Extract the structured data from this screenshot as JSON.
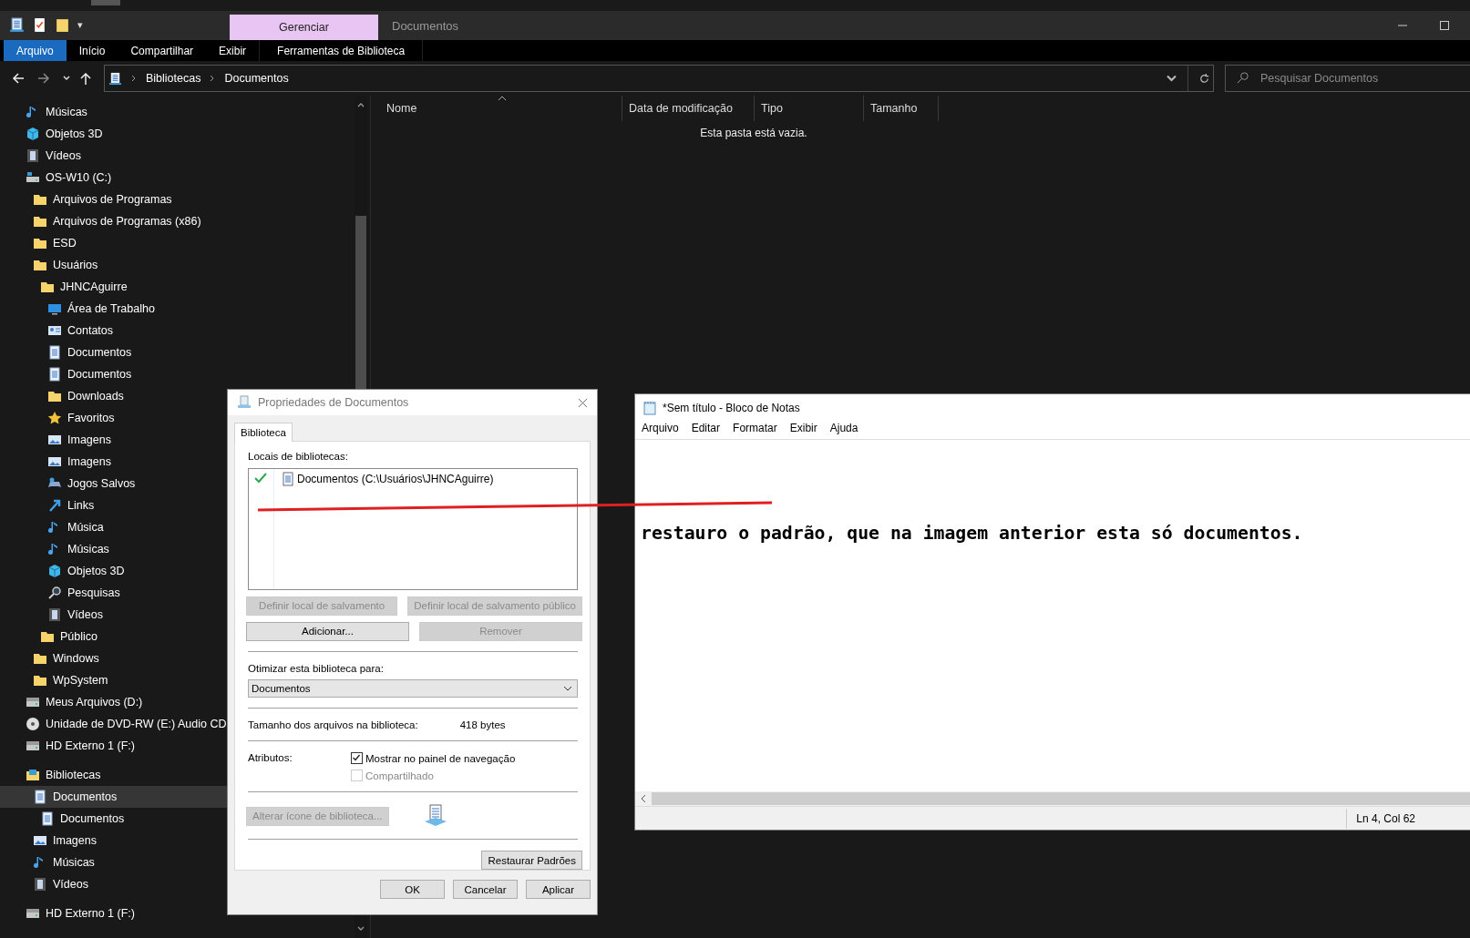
{
  "explorer": {
    "quick_access": [
      "▾"
    ],
    "context_tab": {
      "label": "Gerenciar"
    },
    "title": "Documentos",
    "ribbon_tabs": [
      {
        "label": "Arquivo",
        "selected": true
      },
      {
        "label": "Início",
        "selected": false
      },
      {
        "label": "Compartilhar",
        "selected": false
      },
      {
        "label": "Exibir",
        "selected": false
      },
      {
        "label": "Ferramentas de Biblioteca",
        "selected": false
      }
    ],
    "breadcrumb": [
      "Bibliotecas",
      "Documentos"
    ],
    "search": {
      "placeholder": "Pesquisar Documentos"
    },
    "sidebar": {
      "groups": [
        {
          "items": [
            {
              "label": "Músicas",
              "kind": "music",
              "selected": false
            },
            {
              "label": "Objetos 3D",
              "kind": "cube",
              "selected": false
            },
            {
              "label": "Vídeos",
              "kind": "film",
              "selected": false
            },
            {
              "label": "OS-W10 (C:)",
              "kind": "drive",
              "selected": false,
              "children": [
                {
                  "label": "Arquivos de Programas",
                  "kind": "folder",
                  "selected": false
                },
                {
                  "label": "Arquivos de Programas (x86)",
                  "kind": "folder",
                  "selected": false
                },
                {
                  "label": "ESD",
                  "kind": "folder",
                  "selected": false
                },
                {
                  "label": "Usuários",
                  "kind": "folder",
                  "selected": false,
                  "children": [
                    {
                      "label": "JHNCAguirre",
                      "kind": "folder",
                      "selected": false,
                      "children": [
                        {
                          "label": "Área de Trabalho",
                          "kind": "desktop",
                          "selected": false
                        },
                        {
                          "label": "Contatos",
                          "kind": "contacts",
                          "selected": false
                        },
                        {
                          "label": "Documentos",
                          "kind": "doc",
                          "selected": false
                        },
                        {
                          "label": "Documentos",
                          "kind": "doc",
                          "selected": false
                        },
                        {
                          "label": "Downloads",
                          "kind": "folder",
                          "selected": false
                        },
                        {
                          "label": "Favoritos",
                          "kind": "star",
                          "selected": false
                        },
                        {
                          "label": "Imagens",
                          "kind": "picture",
                          "selected": false
                        },
                        {
                          "label": "Imagens",
                          "kind": "picture",
                          "selected": false
                        },
                        {
                          "label": "Jogos Salvos",
                          "kind": "game",
                          "selected": false
                        },
                        {
                          "label": "Links",
                          "kind": "link",
                          "selected": false
                        },
                        {
                          "label": "Música",
                          "kind": "music",
                          "selected": false
                        },
                        {
                          "label": "Músicas",
                          "kind": "music",
                          "selected": false
                        },
                        {
                          "label": "Objetos 3D",
                          "kind": "cube",
                          "selected": false
                        },
                        {
                          "label": "Pesquisas",
                          "kind": "search",
                          "selected": false
                        },
                        {
                          "label": "Vídeos",
                          "kind": "film",
                          "selected": false
                        }
                      ]
                    },
                    {
                      "label": "Público",
                      "kind": "folder",
                      "selected": false
                    }
                  ]
                },
                {
                  "label": "Windows",
                  "kind": "folder",
                  "selected": false
                },
                {
                  "label": "WpSystem",
                  "kind": "folder",
                  "selected": false
                }
              ]
            },
            {
              "label": "Meus Arquivos (D:)",
              "kind": "hdd",
              "selected": false
            },
            {
              "label": "Unidade de DVD-RW (E:) Audio CD",
              "kind": "disc",
              "selected": false
            },
            {
              "label": "HD Externo 1 (F:)",
              "kind": "hdd",
              "selected": false
            }
          ]
        },
        {
          "items": [
            {
              "label": "Bibliotecas",
              "kind": "library",
              "selected": false,
              "children": [
                {
                  "label": "Documentos",
                  "kind": "doc",
                  "selected": true,
                  "children": [
                    {
                      "label": "Documentos",
                      "kind": "doc",
                      "selected": false
                    }
                  ]
                },
                {
                  "label": "Imagens",
                  "kind": "picture",
                  "selected": false
                },
                {
                  "label": "Músicas",
                  "kind": "music",
                  "selected": false
                },
                {
                  "label": "Vídeos",
                  "kind": "film",
                  "selected": false
                }
              ]
            }
          ]
        },
        {
          "items": [
            {
              "label": "HD Externo 1 (F:)",
              "kind": "hdd",
              "selected": false
            }
          ]
        }
      ]
    },
    "columns": [
      "Nome",
      "Data de modificação",
      "Tipo",
      "Tamanho"
    ],
    "empty_message": "Esta pasta está vazia."
  },
  "properties_dialog": {
    "title": "Propriedades de Documentos",
    "tabs": [
      {
        "label": "Biblioteca",
        "selected": true
      }
    ],
    "locations_label": "Locais de bibliotecas:",
    "locations": [
      {
        "label": "Documentos (C:\\Usuários\\JHNCAguirre)",
        "default": true
      }
    ],
    "buttons_row1": [
      {
        "label": "Definir local de salvamento",
        "disabled": true
      },
      {
        "label": "Definir local de salvamento público",
        "disabled": true
      }
    ],
    "buttons_row2": [
      {
        "label": "Adicionar...",
        "disabled": false
      },
      {
        "label": "Remover",
        "disabled": true
      }
    ],
    "optimize_label": "Otimizar esta biblioteca para:",
    "optimize_value": "Documentos",
    "size_label": "Tamanho dos arquivos na biblioteca:",
    "size_value": "418 bytes",
    "attributes_label": "Atributos:",
    "attributes": [
      {
        "label": "Mostrar no painel de navegação",
        "checked": true,
        "disabled": false
      },
      {
        "label": "Compartilhado",
        "checked": false,
        "disabled": true
      }
    ],
    "change_icon": {
      "label": "Alterar ícone de biblioteca...",
      "disabled": true
    },
    "restore": {
      "label": "Restaurar Padrões",
      "disabled": false
    },
    "footer_buttons": [
      {
        "label": "OK",
        "disabled": false
      },
      {
        "label": "Cancelar",
        "disabled": false
      },
      {
        "label": "Aplicar",
        "disabled": false
      }
    ]
  },
  "notepad": {
    "title": "*Sem título - Bloco de Notas",
    "menu": [
      "Arquivo",
      "Editar",
      "Formatar",
      "Exibir",
      "Ajuda"
    ],
    "text": "restauro o padrão, que na imagem anterior esta só documentos.",
    "status": "Ln 4, Col 62"
  }
}
